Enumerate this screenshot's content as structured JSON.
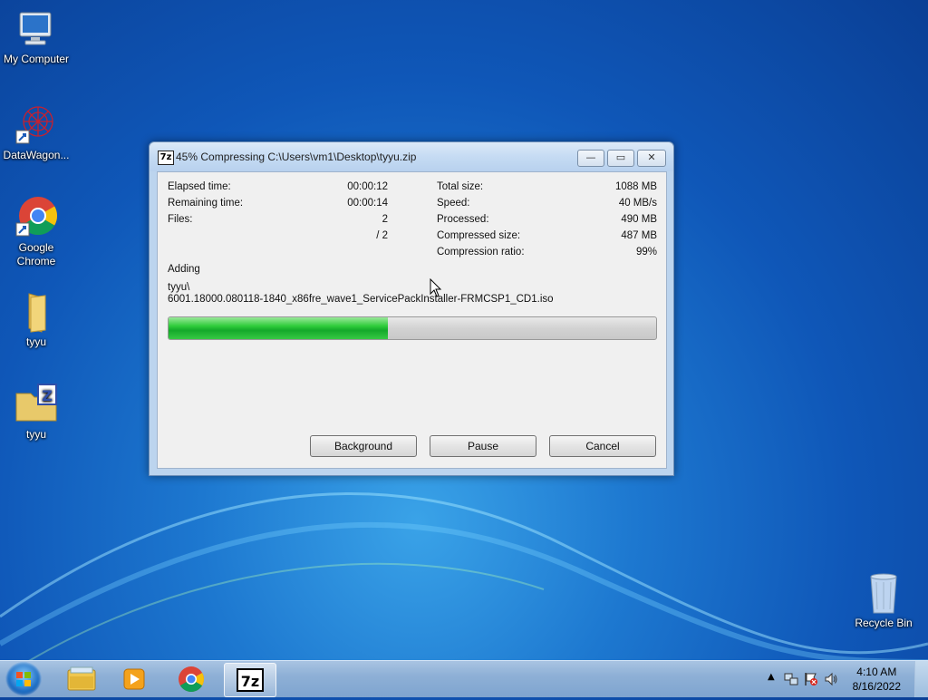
{
  "desktop": {
    "icons": [
      {
        "label": "My Computer"
      },
      {
        "label": "DataWagon..."
      },
      {
        "label": "Google\nChrome"
      },
      {
        "label": "tyyu"
      },
      {
        "label": "tyyu"
      },
      {
        "label": "Recycle Bin"
      }
    ]
  },
  "dialog": {
    "title": "45% Compressing C:\\Users\\vm1\\Desktop\\tyyu.zip",
    "title_icon": "7z",
    "window_buttons": {
      "minimize": "—",
      "maximize": "▭",
      "close": "✕"
    },
    "stats_left": {
      "elapsed_label": "Elapsed time:",
      "elapsed_value": "00:00:12",
      "remaining_label": "Remaining time:",
      "remaining_value": "00:00:14",
      "files_label": "Files:",
      "files_value": "2",
      "files_total": "/ 2"
    },
    "stats_right": {
      "total_label": "Total size:",
      "total_value": "1088 MB",
      "speed_label": "Speed:",
      "speed_value": "40 MB/s",
      "processed_label": "Processed:",
      "processed_value": "490 MB",
      "compressed_label": "Compressed size:",
      "compressed_value": "487 MB",
      "ratio_label": "Compression ratio:",
      "ratio_value": "99%"
    },
    "action": "Adding",
    "file_line1": "tyyu\\",
    "file_line2": "6001.18000.080118-1840_x86fre_wave1_ServicePackInstaller-FRMCSP1_CD1.iso",
    "progress_percent": 45,
    "buttons": {
      "background": "Background",
      "pause": "Pause",
      "cancel": "Cancel"
    }
  },
  "taskbar": {
    "items": [
      "windows-explorer",
      "media-player",
      "google-chrome",
      "7-zip"
    ],
    "clock_time": "4:10 AM",
    "clock_date": "8/16/2022"
  }
}
